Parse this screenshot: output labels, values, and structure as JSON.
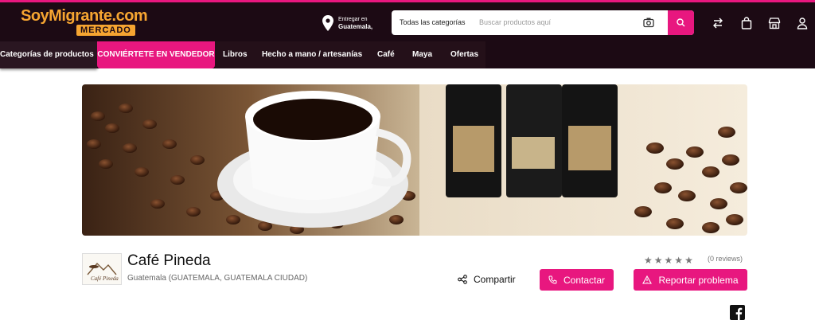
{
  "header": {
    "logo_main": "SoyMigrante.com",
    "logo_sub": "MERCADO",
    "deliver_label": "Entregar en",
    "deliver_location": "Guatemala,",
    "search_category": "Todas las categorías",
    "search_placeholder": "Buscar productos aquí",
    "icons": [
      "location-pin-icon",
      "camera-icon",
      "search-icon",
      "compare-icon",
      "bag-icon",
      "store-icon",
      "user-icon"
    ]
  },
  "nav": {
    "categories_label": "Categorías de productos",
    "vendor_label": "CONVIÉRTETE EN VENDEDOR",
    "items": [
      "Libros",
      "Hecho a mano / artesanías",
      "Café",
      "Maya",
      "Ofertas"
    ]
  },
  "store": {
    "name": "Café Pineda",
    "location": "Guatemala (GUATEMALA, GUATEMALA CIUDAD)",
    "rating": 0,
    "reviews_label": "(0 reviews)",
    "logo_text": "Café Pineda",
    "share_label": "Compartir",
    "contact_label": "Contactar",
    "report_label": "Reportar problema",
    "social": [
      "facebook-icon"
    ]
  },
  "colors": {
    "brand_pink": "#e8177f",
    "header_bg": "#1c0a14",
    "logo_orange": "#f6a531"
  }
}
